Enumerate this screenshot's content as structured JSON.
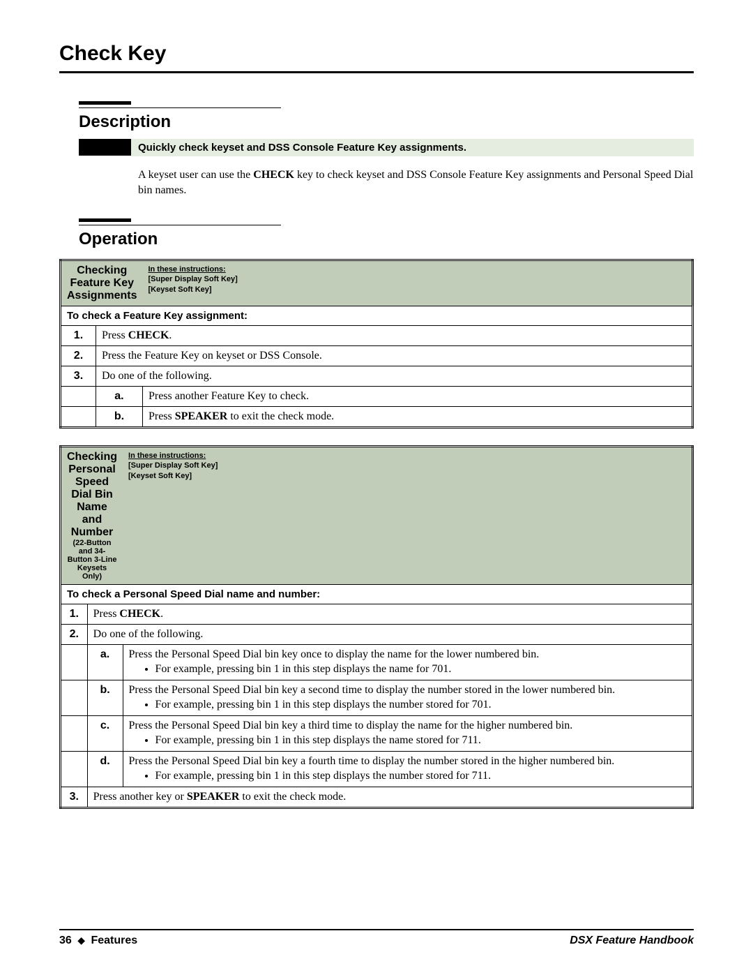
{
  "title": "Check Key",
  "sections": {
    "description": {
      "heading": "Description",
      "callout": "Quickly check keyset and DSS Console Feature Key assignments.",
      "body_pre": "A keyset user can use the ",
      "body_bold": "CHECK",
      "body_post": " key to check keyset and DSS Console Feature Key assignments and Personal Speed Dial bin names."
    },
    "operation": {
      "heading": "Operation"
    }
  },
  "instructions_note": {
    "line1": "In these instructions:",
    "line2": "[Super Display Soft Key]",
    "line3": "[Keyset Soft Key]"
  },
  "table1": {
    "title": "Checking Feature Key Assignments",
    "subhead": "To check a Feature Key assignment:",
    "rows": {
      "r1": {
        "num": "1.",
        "text_pre": "Press ",
        "bold": "CHECK",
        "text_post": "."
      },
      "r2": {
        "num": "2.",
        "text": "Press the Feature Key on keyset or DSS Console."
      },
      "r3": {
        "num": "3.",
        "text": "Do one of the following."
      },
      "r3a": {
        "letter": "a.",
        "text": "Press another Feature Key to check."
      },
      "r3b": {
        "letter": "b.",
        "text_pre": "Press ",
        "bold": "SPEAKER",
        "text_post": " to exit the check mode."
      }
    }
  },
  "table2": {
    "title": "Checking Personal Speed Dial Bin Name and Number",
    "title_sub": "(22-Button and 34-Button 3-Line Keysets Only)",
    "subhead": "To check a Personal Speed Dial name and number:",
    "rows": {
      "r1": {
        "num": "1.",
        "text_pre": "Press ",
        "bold": "CHECK",
        "text_post": "."
      },
      "r2": {
        "num": "2.",
        "text": "Do one of the following."
      },
      "r2a": {
        "letter": "a.",
        "text": "Press the Personal Speed Dial bin key once to display the name for the lower numbered bin.",
        "bullet": "For example, pressing bin 1 in this step displays the name for 701."
      },
      "r2b": {
        "letter": "b.",
        "text": "Press the Personal Speed Dial bin key a second time to display the number stored in the lower numbered bin.",
        "bullet": "For example, pressing bin 1 in this step displays the number stored for 701."
      },
      "r2c": {
        "letter": "c.",
        "text": "Press the Personal Speed Dial bin key a third time to display the name for the higher numbered bin.",
        "bullet": "For example, pressing bin 1 in this step displays the name stored for 711."
      },
      "r2d": {
        "letter": "d.",
        "text": "Press the Personal Speed Dial bin key a fourth time to display the number stored in the higher numbered bin.",
        "bullet": "For example, pressing bin 1 in this step displays the number stored for 711."
      },
      "r3": {
        "num": "3.",
        "text_pre": "Press another key or ",
        "bold": "SPEAKER",
        "text_post": " to exit the check mode."
      }
    }
  },
  "footer": {
    "page_num": "36",
    "section": "Features",
    "book": "DSX Feature Handbook"
  }
}
